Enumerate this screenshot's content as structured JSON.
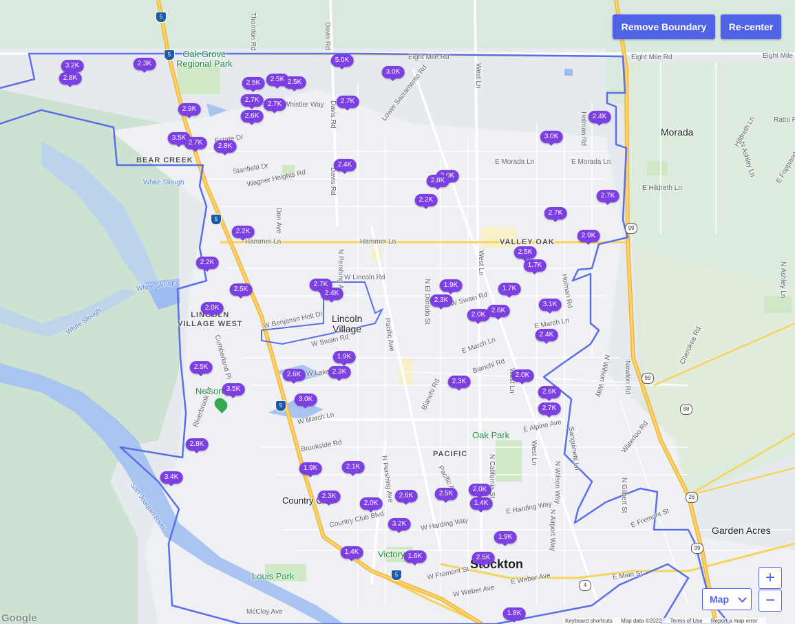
{
  "controls": {
    "remove_boundary": "Remove Boundary",
    "recenter": "Re-center",
    "map_type": "Map",
    "zoom_in": "+",
    "zoom_out": "−"
  },
  "attribution": {
    "google": "Google",
    "keyboard": "Keyboard shortcuts",
    "map_data": "Map data ©2022",
    "terms": "Terms of Use",
    "report": "Report a map error"
  },
  "places": {
    "stockton": "Stockton",
    "morada": "Morada",
    "garden_acres": "Garden Acres",
    "lincoln_village": "Lincoln\nVillage",
    "lincoln_village_west": "LINCOLN\nVILLAGE WEST",
    "bear_creek": "BEAR CREEK",
    "valley_oak": "VALLEY OAK",
    "pacific": "PACIFIC",
    "country_club": "Country Club",
    "oak_grove": "Oak Grove\nRegional Park",
    "oak_park": "Oak Park",
    "nelson": "Nelson",
    "louis_park": "Louis Park",
    "victory_park": "Victory Park"
  },
  "roads": {
    "eight_mile": "Eight Mile Rd",
    "hammer": "Hammer Ln",
    "morada_ln": "E Morada Ln",
    "hildreth": "E Hildreth Ln",
    "march": "W March Ln",
    "e_march": "E March Ln",
    "swain": "W Swain Rd",
    "harding": "W Harding Way",
    "e_harding": "E Harding Way",
    "fremont": "W Fremont St",
    "weber": "W Weber Ave",
    "e_weber": "E Weber Ave",
    "main": "E Main St",
    "mccloy": "McCloy Ave",
    "alpine": "E Alpine Ave",
    "brookside": "Brookside Rd",
    "stanfield": "Stanfield Dr",
    "wagner": "Wagner Heights Rd",
    "whistler": "Whistler Way",
    "estate": "Estate Dr",
    "benjamin": "W Benjamin Holt Dr",
    "lincoln_rd": "W Lincoln Rd",
    "lower_sac": "Lower Sacramento Rd",
    "thornton": "Thornton Rd",
    "davis": "Davis Rd",
    "pershing": "N Pershing Ave",
    "pacific_ave": "Pacific Ave",
    "west_ln": "West Ln",
    "holman": "Holman Rd",
    "el_dorado": "N El Dorado St",
    "bianchi": "Bianchi Rd",
    "california": "N California St",
    "wilson": "N Wilson Way",
    "airport": "N Airport Way",
    "newton": "Newton Rd",
    "cherokee": "Cherokee Rd",
    "waterloo": "Waterloo Rd",
    "country_club_blvd": "Country Club Blvd",
    "hildreth_ln": "Hildreth Ln",
    "ashley": "N Ashley Ln",
    "don_ave": "Don Ave",
    "cumberland": "Cumberland Pl",
    "riverbrook": "Riverbrook Dr",
    "w_lakes": "W Lakes Dr",
    "sanguinetti": "Sanguinetti Ln",
    "gilbert": "N Gilbert St",
    "e_fremont": "E Fremont St",
    "ratto": "Ratto Rd",
    "foppiano": "E Foppiano",
    "san_joaquin": "San Joaquin River",
    "white_slough": "White Slough"
  },
  "highway_shields": {
    "i5_north": "5",
    "i5_mid": "5",
    "i5_south": "5",
    "i5_low": "5",
    "sr99": "99",
    "sr99_south": "99",
    "sr88": "88",
    "sr26": "26",
    "sr4": "4"
  },
  "price_markers": [
    {
      "label": "3.2K"
    },
    {
      "label": "2.8K"
    },
    {
      "label": "2.3K"
    },
    {
      "label": "5.0K"
    },
    {
      "label": "3.0K"
    },
    {
      "label": "2.5K"
    },
    {
      "label": "2.5K"
    },
    {
      "label": "2.5K"
    },
    {
      "label": "2.7K"
    },
    {
      "label": "2.7K"
    },
    {
      "label": "2.7K"
    },
    {
      "label": "2.6K"
    },
    {
      "label": "2.9K"
    },
    {
      "label": "3.5K"
    },
    {
      "label": "2.7K"
    },
    {
      "label": "2.8K"
    },
    {
      "label": "2.4K"
    },
    {
      "label": "2.4K"
    },
    {
      "label": "3.0K"
    },
    {
      "label": "2.0K"
    },
    {
      "label": "2.8K"
    },
    {
      "label": "2.2K"
    },
    {
      "label": "2.7K"
    },
    {
      "label": "2.7K"
    },
    {
      "label": "2.2K"
    },
    {
      "label": "2.9K"
    },
    {
      "label": "2.2K"
    },
    {
      "label": "2.5K"
    },
    {
      "label": "1.7K"
    },
    {
      "label": "2.5K"
    },
    {
      "label": "2.7K"
    },
    {
      "label": "2.4K"
    },
    {
      "label": "1.9K"
    },
    {
      "label": "2.3K"
    },
    {
      "label": "1.7K"
    },
    {
      "label": "2.0K"
    },
    {
      "label": "2.6K"
    },
    {
      "label": "2.0K"
    },
    {
      "label": "3.1K"
    },
    {
      "label": "2.4K"
    },
    {
      "label": "1.9K"
    },
    {
      "label": "2.5K"
    },
    {
      "label": "2.6K"
    },
    {
      "label": "2.3K"
    },
    {
      "label": "2.3K"
    },
    {
      "label": "2.0K"
    },
    {
      "label": "3.5K"
    },
    {
      "label": "3.0K"
    },
    {
      "label": "2.6K"
    },
    {
      "label": "2.7K"
    },
    {
      "label": "2.8K"
    },
    {
      "label": "3.4K"
    },
    {
      "label": "1.9K"
    },
    {
      "label": "2.1K"
    },
    {
      "label": "2.3K"
    },
    {
      "label": "2.0K"
    },
    {
      "label": "2.6K"
    },
    {
      "label": "2.5K"
    },
    {
      "label": "2.0K"
    },
    {
      "label": "1.4K"
    },
    {
      "label": "3.2K"
    },
    {
      "label": "1.9K"
    },
    {
      "label": "1.4K"
    },
    {
      "label": "1.6K"
    },
    {
      "label": "2.5K"
    },
    {
      "label": "1.8K"
    }
  ],
  "colors": {
    "marker": "#7b3fe4",
    "boundary": "#5a6ee8",
    "button": "#4f63e7",
    "highway": "#f5c542",
    "water": "#9dbdf2",
    "park": "#cfe8c6",
    "land": "#e9ebef",
    "urban": "#f4f5f7"
  }
}
